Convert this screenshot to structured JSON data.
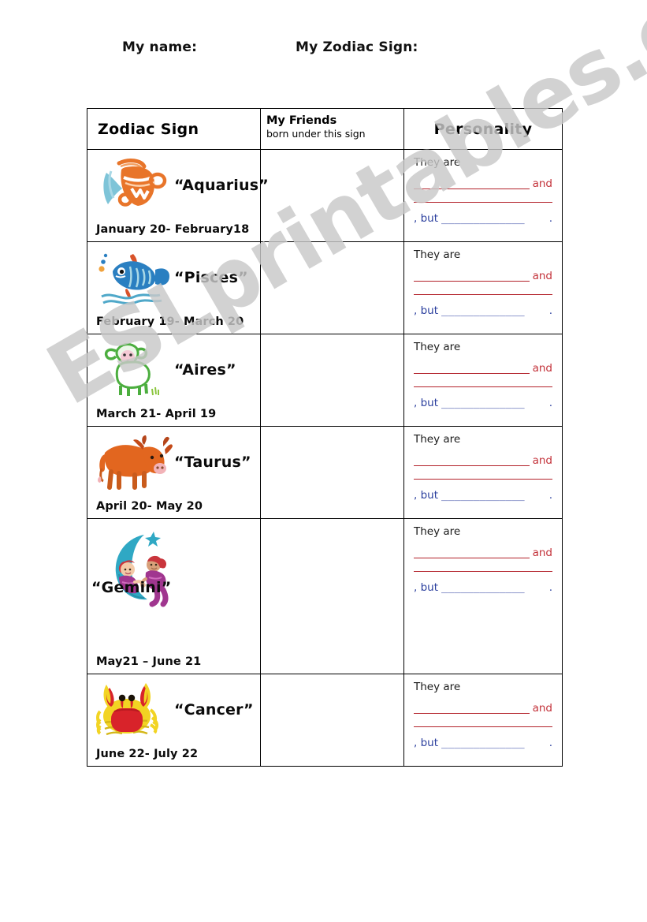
{
  "header": {
    "name_label": "My name:",
    "zodiac_label": "My Zodiac Sign:"
  },
  "table": {
    "headers": {
      "sign": "Zodiac Sign",
      "friends_main": "My Friends",
      "friends_sub": "born under this sign",
      "personality": "Personality"
    },
    "personality_template": {
      "intro": "They are",
      "connector": "and",
      "contrast": ", but",
      "blank_line": "_______________",
      "blank_blue": "_____________",
      "period": "."
    },
    "rows": [
      {
        "sign": "“Aquarius”",
        "dates": "January 20- February18",
        "icon": "aquarius-urn-icon",
        "friends": "",
        "personality": {
          "intro": "They are",
          "connector": "and",
          "contrast": ", but",
          "blank_blue": "_____________",
          "period": "."
        }
      },
      {
        "sign": "“Pisces”",
        "dates": "February 19- March 20",
        "icon": "pisces-fish-icon",
        "friends": "",
        "personality": {
          "intro": "They are",
          "connector": "and",
          "contrast": ", but",
          "blank_blue": "_____________",
          "period": "."
        }
      },
      {
        "sign": "“Aires”",
        "dates": "March 21- April 19",
        "icon": "aries-ram-icon",
        "friends": "",
        "personality": {
          "intro": "They are",
          "connector": "and",
          "contrast": ", but",
          "blank_blue": "_____________",
          "period": "."
        }
      },
      {
        "sign": "“Taurus”",
        "dates": "April 20- May 20",
        "icon": "taurus-bull-icon",
        "friends": "",
        "personality": {
          "intro": "They are",
          "connector": "and",
          "contrast": ", but",
          "blank_blue": "_____________",
          "period": "."
        }
      },
      {
        "sign": "“Gemini”",
        "dates": "May21 – June 21",
        "icon": "gemini-moon-twins-icon",
        "friends": "",
        "personality": {
          "intro": "They are",
          "connector": "and",
          "contrast": ", but",
          "blank_blue": "_____________",
          "period": "."
        }
      },
      {
        "sign": "“Cancer”",
        "dates": "June 22- July 22",
        "icon": "cancer-crab-icon",
        "friends": "",
        "personality": {
          "intro": "They are",
          "connector": "and",
          "contrast": ", but",
          "blank_blue": "_____________",
          "period": "."
        }
      }
    ]
  },
  "watermark": {
    "text": "ESLprintables.com",
    "color": "#c9c9c9"
  },
  "colors": {
    "rule_red": "#b3222b",
    "word_and_red": "#c3323a",
    "blue_text": "#2b3f9e",
    "border": "#000000",
    "aquarius_orange": "#e8752a",
    "aquarius_water": "#7ec4d8",
    "pisces_blue": "#2a7fc1",
    "pisces_fin": "#d9532a",
    "aries_green": "#4cae3f",
    "aries_face": "#f4c9d4",
    "taurus_orange": "#e2661f",
    "gemini_moon": "#2fa8c4",
    "gemini_cloth": "#a0368f",
    "cancer_red": "#d8232a",
    "cancer_yellow": "#f2d423"
  }
}
